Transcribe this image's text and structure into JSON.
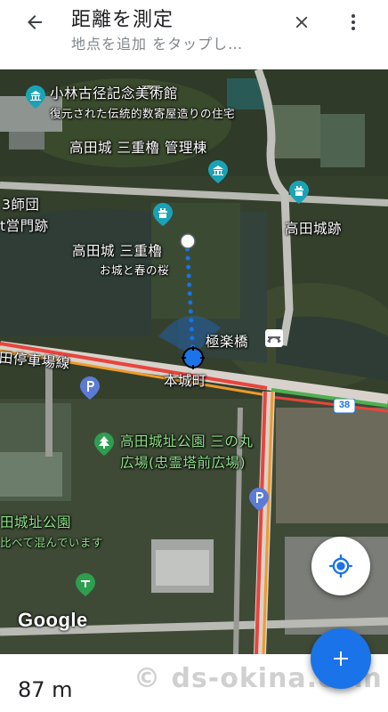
{
  "header": {
    "title": "距離を測定",
    "subtitle": "地点を追加 をタップし…"
  },
  "map": {
    "labels": {
      "museum_name": "小林古径記念美術館",
      "museum_desc": "復元された伝統的数寄屋造りの住宅",
      "sangoyagura_office": "高田城 三重櫓 管理棟",
      "division_gate_1": "3師団",
      "division_gate_2": "t営門跡",
      "takada_castle_ruins": "高田城跡",
      "sangoyagura": "高田城 三重櫓",
      "sangoyagura_desc": "お城と春の桜",
      "gokurakubashi": "極楽橋",
      "station_line": "田停車場線",
      "honjomachi": "本城町",
      "route_number": "38",
      "park_sannomaru_1": "高田城址公園 三の丸",
      "park_sannomaru_2": "広場(忠霊塔前広場)",
      "park_name": "田城址公園",
      "park_desc": "比べて混んでいます",
      "google_logo": "Google"
    }
  },
  "bottom": {
    "distance": "87 m",
    "watermark": "© ds-okina.com"
  },
  "colors": {
    "accent": "#1a73e8",
    "poi_teal": "#1aa3b7",
    "parking": "#5c7bd6",
    "park_green": "#2e9e4f"
  }
}
